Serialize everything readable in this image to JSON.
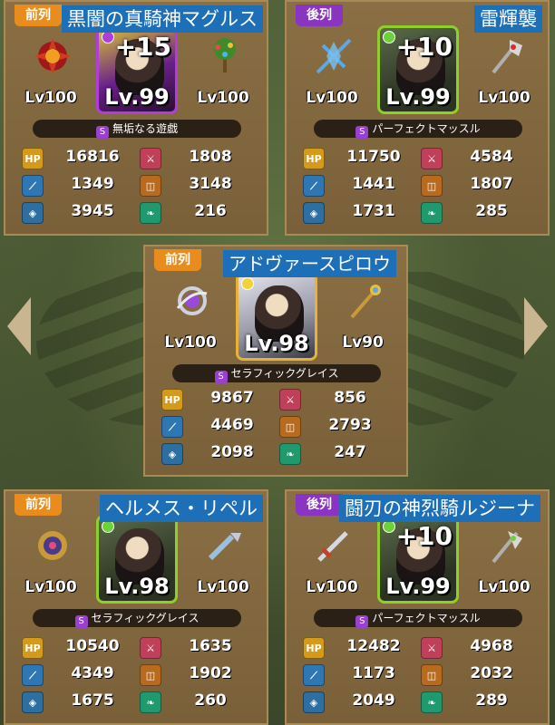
{
  "colors": {
    "front_tag": "#e88d1d",
    "back_tag": "#8a34c2",
    "name_tag": "#1d6fb8",
    "card_bg": "#8a6f44"
  },
  "navigation": {
    "prev_icon": "chevron-left-icon",
    "next_icon": "chevron-right-icon"
  },
  "units": [
    {
      "position": "前列",
      "name": "黒闇の真騎神マグルス",
      "plus": "+15",
      "level": "Lv.99",
      "left_gear_level": "Lv100",
      "right_gear_level": "Lv100",
      "skill": "無垢なる遊戯",
      "skill_icon": "S",
      "stats": {
        "hp": "16816",
        "atk": "1808",
        "spd": "1349",
        "brk": "3148",
        "def": "3945",
        "res": "216"
      }
    },
    {
      "position": "後列",
      "name": "雷輝襲",
      "plus": "+10",
      "level": "Lv.99",
      "left_gear_level": "Lv100",
      "right_gear_level": "Lv100",
      "skill": "パーフェクトマッスル",
      "skill_icon": "S",
      "stats": {
        "hp": "11750",
        "atk": "4584",
        "spd": "1441",
        "brk": "1807",
        "def": "1731",
        "res": "285"
      }
    },
    {
      "position": "前列",
      "name": "アドヴァースピロウ",
      "plus": "",
      "level": "Lv.98",
      "left_gear_level": "Lv100",
      "right_gear_level": "Lv90",
      "skill": "セラフィックグレイス",
      "skill_icon": "S",
      "stats": {
        "hp": "9867",
        "atk": "856",
        "spd": "4469",
        "brk": "2793",
        "def": "2098",
        "res": "247"
      }
    },
    {
      "position": "前列",
      "name": "ヘルメス・リペル",
      "plus": "",
      "level": "Lv.98",
      "left_gear_level": "Lv100",
      "right_gear_level": "Lv100",
      "skill": "セラフィックグレイス",
      "skill_icon": "S",
      "stats": {
        "hp": "10540",
        "atk": "1635",
        "spd": "4349",
        "brk": "1902",
        "def": "1675",
        "res": "260"
      }
    },
    {
      "position": "後列",
      "name": "闘刃の神烈騎ルジーナ",
      "plus": "+10",
      "level": "Lv.99",
      "left_gear_level": "Lv100",
      "right_gear_level": "Lv100",
      "skill": "パーフェクトマッスル",
      "skill_icon": "S",
      "stats": {
        "hp": "12482",
        "atk": "4968",
        "spd": "1173",
        "brk": "2032",
        "def": "2049",
        "res": "289"
      }
    }
  ],
  "stat_labels": {
    "hp": "HP"
  }
}
